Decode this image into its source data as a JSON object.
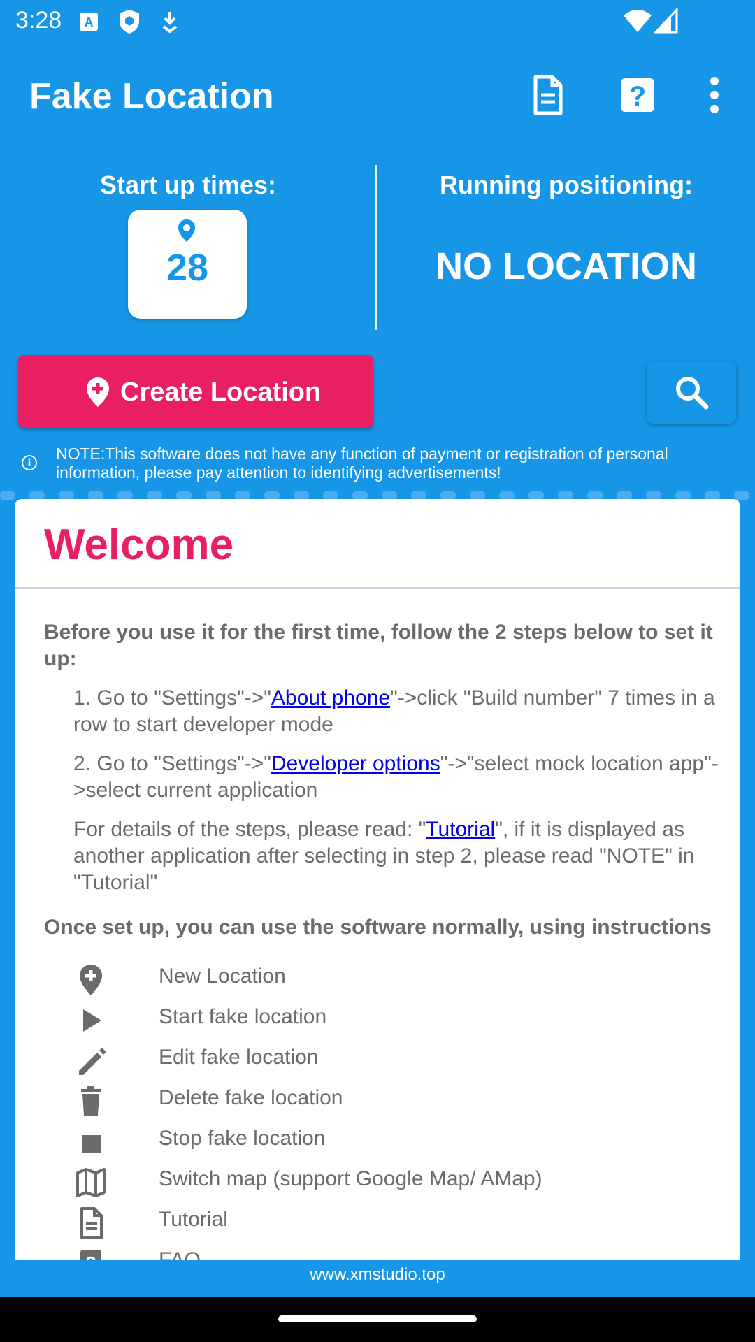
{
  "status_bar": {
    "time": "3:28"
  },
  "app_bar": {
    "title": "Fake Location"
  },
  "stats": {
    "startup_label": "Start up times:",
    "startup_count": "28",
    "running_label": "Running positioning:",
    "running_value": "NO LOCATION"
  },
  "actions": {
    "create_label": "Create Location"
  },
  "note": "NOTE:This software does not have any function of payment or registration of personal information, please pay attention to identifying advertisements!",
  "card": {
    "title": "Welcome",
    "intro": "Before you use it for the first time, follow the 2 steps below to set it up:",
    "step1_pre": "1. Go to \"Settings\"->\"",
    "step1_link": "About phone",
    "step1_post": "\"->click \"Build number\" 7 times in a row to start developer mode",
    "step2_pre": "2. Go to \"Settings\"->\"",
    "step2_link": "Developer options",
    "step2_post": "\"->\"select mock location app\"->select current application",
    "details_pre": "For details of the steps, please read: \"",
    "details_link": "Tutorial",
    "details_post": "\", if it is displayed as another application after selecting in step 2, please read \"NOTE\" in \"Tutorial\"",
    "instructions_heading": "Once set up, you can use the software normally, using instructions",
    "legend": [
      {
        "icon": "add-location-icon",
        "label": "New Location"
      },
      {
        "icon": "play-icon",
        "label": "Start fake location"
      },
      {
        "icon": "pencil-icon",
        "label": "Edit fake location"
      },
      {
        "icon": "trash-icon",
        "label": "Delete fake location"
      },
      {
        "icon": "stop-icon",
        "label": "Stop fake location"
      },
      {
        "icon": "map-icon",
        "label": "Switch map (support Google Map/ AMap)"
      },
      {
        "icon": "document-icon",
        "label": "Tutorial"
      },
      {
        "icon": "help-icon",
        "label": "FAQ"
      }
    ]
  },
  "footer": {
    "url": "www.xmstudio.top"
  },
  "colors": {
    "primary": "#1796E8",
    "accent": "#E91E63",
    "text_gray": "#6B6B6B",
    "link": "#0000EE"
  }
}
